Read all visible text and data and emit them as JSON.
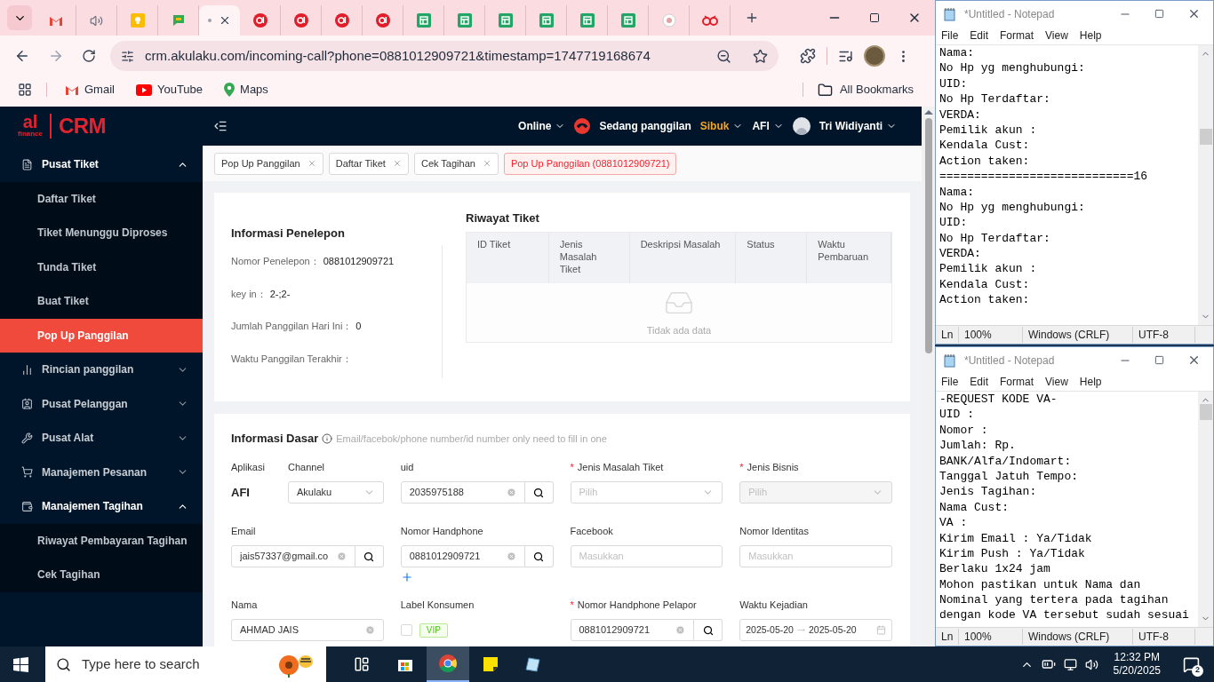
{
  "browser": {
    "tabs": [
      {
        "kind": "gmail",
        "selected": false
      },
      {
        "kind": "audio",
        "selected": false
      },
      {
        "kind": "keep",
        "selected": false
      },
      {
        "kind": "chat",
        "selected": false
      },
      {
        "kind": "blank",
        "selected": true
      },
      {
        "kind": "akulaku",
        "selected": false
      },
      {
        "kind": "akulaku",
        "selected": false
      },
      {
        "kind": "akulaku",
        "selected": false
      },
      {
        "kind": "akulaku",
        "selected": false
      },
      {
        "kind": "sheets",
        "selected": false
      },
      {
        "kind": "sheets",
        "selected": false
      },
      {
        "kind": "sheets",
        "selected": false
      },
      {
        "kind": "sheets",
        "selected": false
      },
      {
        "kind": "sheets",
        "selected": false
      },
      {
        "kind": "sheets",
        "selected": false
      },
      {
        "kind": "circle",
        "selected": false
      },
      {
        "kind": "loop",
        "selected": false
      }
    ],
    "url": "crm.akulaku.com/incoming-call?phone=0881012909721&timestamp=1747719168674",
    "bookmarks": [
      {
        "kind": "gmail",
        "label": "Gmail"
      },
      {
        "kind": "youtube",
        "label": "YouTube"
      },
      {
        "kind": "maps",
        "label": "Maps"
      }
    ],
    "all_bookmarks": "All Bookmarks"
  },
  "crm": {
    "logo": {
      "mark": "al",
      "sub": "finance",
      "name": "CRM"
    },
    "header": {
      "status": "Online",
      "call_state": "Sedang panggilan",
      "busy": "Sibuk",
      "app": "AFI",
      "user": "Tri Widiyanti"
    },
    "sidebar": [
      {
        "label": "Pusat Tiket",
        "expanded": true,
        "children": [
          {
            "label": "Daftar Tiket",
            "selected": false
          },
          {
            "label": "Tiket Menunggu Diproses",
            "selected": false
          },
          {
            "label": "Tunda Tiket",
            "selected": false
          },
          {
            "label": "Buat Tiket",
            "selected": false
          },
          {
            "label": "Pop Up Panggilan",
            "selected": true
          }
        ]
      },
      {
        "label": "Rincian panggilan",
        "expanded": false
      },
      {
        "label": "Pusat Pelanggan",
        "expanded": false
      },
      {
        "label": "Pusat Alat",
        "expanded": false
      },
      {
        "label": "Manajemen Pesanan",
        "expanded": false
      },
      {
        "label": "Manajemen Tagihan",
        "expanded": true,
        "children": [
          {
            "label": "Riwayat Pembayaran Tagihan",
            "selected": false
          },
          {
            "label": "Cek Tagihan",
            "selected": false
          }
        ]
      }
    ],
    "page_tabs": [
      {
        "label": "Pop Up Panggilan",
        "selected": false,
        "closable": true
      },
      {
        "label": "Daftar Tiket",
        "selected": false,
        "closable": true
      },
      {
        "label": "Cek Tagihan",
        "selected": false,
        "closable": true
      },
      {
        "label": "Pop Up Panggilan (0881012909721)",
        "selected": true,
        "closable": false
      }
    ],
    "caller_info": {
      "title": "Informasi Penelepon",
      "fields": [
        {
          "label": "Nomor Penelepon：",
          "value": "0881012909721"
        },
        {
          "label": "key in：",
          "value": "2-;2-"
        },
        {
          "label": "Jumlah Panggilan Hari Ini：",
          "value": "0"
        },
        {
          "label": "Waktu Panggilan Terakhir："
        }
      ]
    },
    "ticket_history": {
      "title": "Riwayat Tiket",
      "columns": [
        "ID Tiket",
        "Jenis Masalah Tiket",
        "Deskripsi Masalah",
        "Status",
        "Waktu Pembaruan"
      ],
      "empty_text": "Tidak ada data"
    },
    "basic_info": {
      "title": "Informasi Dasar",
      "hint": "Email/facebok/phone number/id number only need to fill in one",
      "rows": [
        [
          {
            "kind": "pair",
            "fields": [
              {
                "kind": "static",
                "label": "Aplikasi",
                "value": "AFI"
              },
              {
                "kind": "select",
                "label": "Channel",
                "value": "Akulaku"
              }
            ]
          },
          {
            "kind": "search",
            "label": "uid",
            "value": "2035975188"
          },
          {
            "kind": "select",
            "mark": "*",
            "label": "Jenis Masalah Tiket",
            "placeholder": "Pilih"
          },
          {
            "kind": "select",
            "mark": "*",
            "label": "Jenis Bisnis",
            "placeholder": "Pilih",
            "disabled": true
          }
        ],
        [
          {
            "kind": "search",
            "label": "Email",
            "value": "jais57337@gmail.co"
          },
          {
            "kind": "search",
            "label": "Nomor Handphone",
            "value": "0881012909721",
            "addable": true
          },
          {
            "kind": "input",
            "label": "Facebook",
            "placeholder": "Masukkan"
          },
          {
            "kind": "input",
            "label": "Nomor Identitas",
            "placeholder": "Masukkan"
          }
        ],
        [
          {
            "kind": "input",
            "label": "Nama",
            "value": "AHMAD JAIS"
          },
          {
            "kind": "checkbox-tag",
            "label": "Label Konsumen",
            "tag": "VIP",
            "checked": false
          },
          {
            "kind": "search",
            "mark": "*",
            "label": "Nomor Handphone Pelapor",
            "value": "0881012909721"
          },
          {
            "kind": "date-range",
            "label": "Waktu Kejadian",
            "start": "2025-05-20",
            "end": "2025-05-20"
          }
        ]
      ]
    }
  },
  "notepads": [
    {
      "title": "*Untitled - Notepad",
      "menu": [
        "File",
        "Edit",
        "Format",
        "View",
        "Help"
      ],
      "lines": [
        "Nama:",
        "No Hp yg menghubungi:",
        "UID:",
        "No Hp Terdaftar:",
        "VERDA:",
        "Pemilik akun :",
        "Kendala Cust:",
        "Action taken:",
        "============================16",
        "Nama:",
        "No Hp yg menghubungi:",
        "UID:",
        "No Hp Terdaftar:",
        "VERDA:",
        "Pemilik akun :",
        "Kendala Cust:",
        "Action taken:"
      ],
      "status": [
        "Ln",
        "100%",
        "Windows (CRLF)",
        "UTF-8"
      ]
    },
    {
      "title": "*Untitled - Notepad",
      "menu": [
        "File",
        "Edit",
        "Format",
        "View",
        "Help"
      ],
      "lines": [
        "-REQUEST KODE VA-",
        "UID :",
        "Nomor :",
        "Jumlah: Rp.",
        "BANK/Alfa/Indomart:",
        "Tanggal Jatuh Tempo:",
        "Jenis Tagihan:",
        "Nama Cust:",
        "VA :",
        "Kirim Email : Ya/Tidak",
        "Kirim Push : Ya/Tidak",
        "Berlaku 1x24 jam",
        "Mohon pastikan untuk Nama dan",
        "Nominal yang tertera pada tagihan",
        "dengan kode VA tersebut sudah sesuai"
      ],
      "status": [
        "Ln",
        "100%",
        "Windows (CRLF)",
        "UTF-8"
      ]
    }
  ],
  "taskbar": {
    "search_placeholder": "Type here to search",
    "time": "12:32 PM",
    "date": "5/20/2025",
    "notifications": "2"
  }
}
